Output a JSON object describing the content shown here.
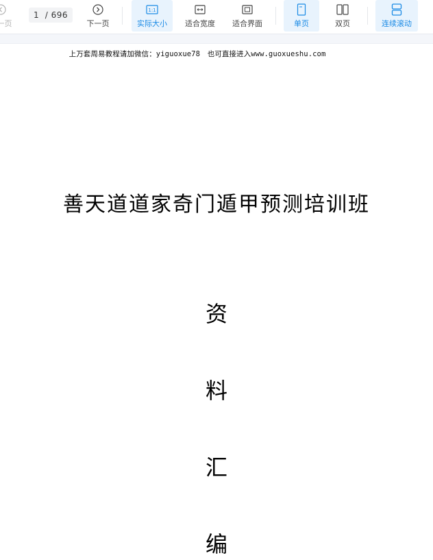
{
  "toolbar": {
    "prev_label": "上一页",
    "page_current": "1",
    "page_total": "696",
    "next_label": "下一页",
    "actual_size_label": "实际大小",
    "actual_size_icon_text": "1:1",
    "fit_width_label": "适合宽度",
    "fit_page_label": "适合界面",
    "single_page_label": "单页",
    "double_page_label": "双页",
    "continuous_label": "连续滚动",
    "accent_color": "#1a8ae5",
    "icons": {
      "prev": "chevron-left-circle-icon",
      "next": "chevron-right-circle-icon",
      "actual_size": "actual-size-icon",
      "fit_width": "fit-width-icon",
      "fit_page": "fit-page-icon",
      "single_page": "single-page-icon",
      "double_page": "double-page-icon",
      "continuous": "continuous-scroll-icon"
    }
  },
  "document": {
    "header_text": "上万套周易教程请加微信：yiguoxue78　也可直接进入www.guoxueshu.com",
    "title": "善天道道家奇门遁甲预测培训班",
    "subtitle_chars": [
      "资",
      "料",
      "汇",
      "编"
    ]
  }
}
